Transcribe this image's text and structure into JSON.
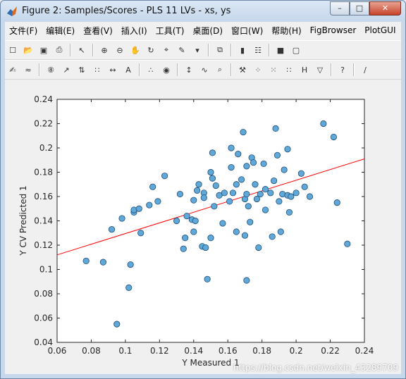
{
  "window": {
    "title": "Figure 2: Samples/Scores - PLS 11 LVs - xs, ys",
    "buttons": {
      "minimize": "–",
      "maximize": "□",
      "close": "✕"
    }
  },
  "menu": [
    "文件(F)",
    "编辑(E)",
    "查看(V)",
    "插入(I)",
    "工具(T)",
    "桌面(D)",
    "窗口(W)",
    "帮助(H)",
    "FigBrowser",
    "PlotGUI"
  ],
  "toolbar1": [
    "new-figure-icon",
    "open-folder-icon",
    "save-icon",
    "print-icon",
    "sep",
    "pointer-icon",
    "sep",
    "zoom-in-icon",
    "zoom-out-icon",
    "pan-hand-icon",
    "rotate-icon",
    "data-cursor-icon",
    "brush-icon",
    "dropdown-arrow-icon",
    "sep",
    "link-plot-icon",
    "sep",
    "colorbar-icon",
    "legend-icon",
    "sep",
    "hide-plot-tools-icon",
    "show-plot-tools-icon"
  ],
  "toolbar2": [
    "edit-icon",
    "plot-icon",
    "sep",
    "sample-order-icon",
    "set-axis-icon",
    "sort-icon",
    "select-icon",
    "split-icon",
    "label-icon",
    "sep",
    "scatter-icon",
    "classes-icon",
    "sep",
    "updown-icon",
    "wave-icon",
    "zoom-data-icon",
    "sep",
    "tools-icon",
    "select-points-icon",
    "grid-points-icon",
    "scale-points-icon",
    "hide-icon",
    "filter-icon",
    "sep",
    "help-icon",
    "sep",
    "line-slope-icon"
  ],
  "chart_data": {
    "type": "scatter",
    "xlabel": "Y Measured 1",
    "ylabel": "Y CV Predicted 1",
    "xlim": [
      0.06,
      0.24
    ],
    "ylim": [
      0.04,
      0.24
    ],
    "xticks": [
      "0.06",
      "0.08",
      "0.1",
      "0.12",
      "0.14",
      "0.16",
      "0.18",
      "0.2",
      "0.22",
      "0.24"
    ],
    "yticks": [
      "0.04",
      "0.06",
      "0.08",
      "0.1",
      "0.12",
      "0.14",
      "0.16",
      "0.18",
      "0.2",
      "0.22",
      "0.24"
    ],
    "grid": false,
    "marker_color": "#5fa8d8",
    "marker_edge": "#1f4e79",
    "fit_line": {
      "color": "#ff0000",
      "x": [
        0.06,
        0.24
      ],
      "y": [
        0.112,
        0.191
      ]
    },
    "points": [
      [
        0.077,
        0.107
      ],
      [
        0.087,
        0.106
      ],
      [
        0.092,
        0.133
      ],
      [
        0.095,
        0.055
      ],
      [
        0.098,
        0.142
      ],
      [
        0.102,
        0.085
      ],
      [
        0.103,
        0.104
      ],
      [
        0.105,
        0.147
      ],
      [
        0.105,
        0.149
      ],
      [
        0.108,
        0.15
      ],
      [
        0.109,
        0.13
      ],
      [
        0.114,
        0.153
      ],
      [
        0.116,
        0.168
      ],
      [
        0.119,
        0.156
      ],
      [
        0.123,
        0.177
      ],
      [
        0.13,
        0.14
      ],
      [
        0.132,
        0.162
      ],
      [
        0.134,
        0.117
      ],
      [
        0.135,
        0.126
      ],
      [
        0.136,
        0.144
      ],
      [
        0.139,
        0.141
      ],
      [
        0.14,
        0.131
      ],
      [
        0.14,
        0.157
      ],
      [
        0.141,
        0.14
      ],
      [
        0.142,
        0.165
      ],
      [
        0.143,
        0.17
      ],
      [
        0.145,
        0.119
      ],
      [
        0.146,
        0.163
      ],
      [
        0.146,
        0.159
      ],
      [
        0.147,
        0.118
      ],
      [
        0.148,
        0.092
      ],
      [
        0.15,
        0.126
      ],
      [
        0.15,
        0.18
      ],
      [
        0.151,
        0.175
      ],
      [
        0.151,
        0.196
      ],
      [
        0.152,
        0.152
      ],
      [
        0.153,
        0.169
      ],
      [
        0.155,
        0.161
      ],
      [
        0.157,
        0.138
      ],
      [
        0.158,
        0.163
      ],
      [
        0.161,
        0.156
      ],
      [
        0.162,
        0.184
      ],
      [
        0.162,
        0.2
      ],
      [
        0.163,
        0.163
      ],
      [
        0.165,
        0.131
      ],
      [
        0.165,
        0.17
      ],
      [
        0.166,
        0.195
      ],
      [
        0.168,
        0.174
      ],
      [
        0.169,
        0.213
      ],
      [
        0.17,
        0.128
      ],
      [
        0.17,
        0.158
      ],
      [
        0.171,
        0.185
      ],
      [
        0.171,
        0.162
      ],
      [
        0.171,
        0.091
      ],
      [
        0.172,
        0.152
      ],
      [
        0.173,
        0.139
      ],
      [
        0.174,
        0.192
      ],
      [
        0.175,
        0.188
      ],
      [
        0.176,
        0.17
      ],
      [
        0.177,
        0.158
      ],
      [
        0.178,
        0.118
      ],
      [
        0.179,
        0.162
      ],
      [
        0.181,
        0.187
      ],
      [
        0.182,
        0.166
      ],
      [
        0.182,
        0.149
      ],
      [
        0.185,
        0.163
      ],
      [
        0.186,
        0.127
      ],
      [
        0.187,
        0.173
      ],
      [
        0.188,
        0.216
      ],
      [
        0.189,
        0.194
      ],
      [
        0.19,
        0.156
      ],
      [
        0.191,
        0.131
      ],
      [
        0.192,
        0.162
      ],
      [
        0.193,
        0.182
      ],
      [
        0.195,
        0.161
      ],
      [
        0.195,
        0.199
      ],
      [
        0.196,
        0.147
      ],
      [
        0.197,
        0.16
      ],
      [
        0.2,
        0.163
      ],
      [
        0.203,
        0.179
      ],
      [
        0.205,
        0.168
      ],
      [
        0.208,
        0.16
      ],
      [
        0.216,
        0.22
      ],
      [
        0.222,
        0.209
      ],
      [
        0.224,
        0.155
      ],
      [
        0.23,
        0.121
      ]
    ]
  },
  "watermark": "https://blog.csdn.net/weixin_43289709"
}
